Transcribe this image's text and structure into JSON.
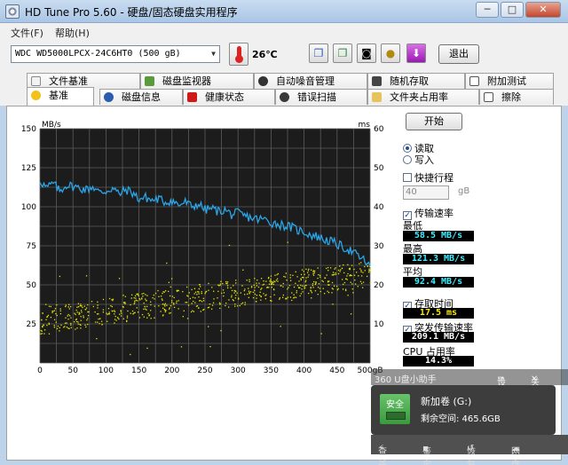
{
  "window": {
    "title": "HD Tune Pro 5.60 - 硬盘/固态硬盘实用程序",
    "buttons": [
      "─",
      "□",
      "✕"
    ]
  },
  "menu": [
    "文件(F)",
    "帮助(H)"
  ],
  "toolbar": {
    "drive": "WDC WD5000LPCX-24C6HT0 (500 gB)",
    "temperature": "26℃",
    "exit_label": "退出",
    "tool_icons": [
      "copy-icon",
      "paste-icon",
      "camera-icon",
      "coins-icon",
      "download-icon"
    ]
  },
  "tabs": {
    "row1": [
      "文件基准",
      "磁盘监视器",
      "自动噪音管理",
      "随机存取",
      "附加测试"
    ],
    "row2": [
      "基准",
      "磁盘信息",
      "健康状态",
      "错误扫描",
      "文件夹占用率",
      "擦除"
    ],
    "active": "基准"
  },
  "controls": {
    "start_label": "开始",
    "read_label": "读取",
    "write_label": "写入",
    "short_stroke_label": "快捷行程",
    "short_stroke_value": "40",
    "short_stroke_unit": "gB",
    "transfer_rate_label": "传输速率",
    "min_label": "最低",
    "min_value": "58.5 MB/s",
    "max_label": "最高",
    "max_value": "121.3 MB/s",
    "avg_label": "平均",
    "avg_value": "92.4 MB/s",
    "access_time_label": "存取时间",
    "access_time_value": "17.5 ms",
    "burst_label": "突发传输速率",
    "burst_value": "209.1 MB/s",
    "cpu_label": "CPU 占用率",
    "cpu_value": "14.3%"
  },
  "overlay": {
    "title": "360 U盘小助手",
    "settings": "设置",
    "close": "关闭",
    "safe": "安全",
    "volume_name": "新加卷 (G:)",
    "free_space": "剩余空间: 465.6GB",
    "actions": [
      "查杀",
      "鉴定",
      "恢复",
      "网盘"
    ]
  },
  "colors": {
    "transfer_line": "#2aa5e8",
    "access_points": "#e6e600",
    "chart_bg": "#1c1c1c"
  },
  "chart_data": {
    "type": "line",
    "xlabel": "",
    "x_unit": "gB",
    "left_unit": "MB/s",
    "right_unit": "ms",
    "xlim": [
      0,
      500
    ],
    "ylim_left": [
      0,
      150
    ],
    "ylim_right": [
      0,
      60
    ],
    "x_ticks": [
      0,
      50,
      100,
      150,
      200,
      250,
      300,
      350,
      400,
      450,
      500
    ],
    "y_ticks_left": [
      25,
      50,
      75,
      100,
      125,
      150
    ],
    "y_ticks_right": [
      10,
      20,
      30,
      40,
      50,
      60
    ],
    "grid": true,
    "series": [
      {
        "name": "传输速率",
        "axis": "left",
        "x": [
          0,
          10,
          20,
          30,
          40,
          50,
          60,
          70,
          80,
          90,
          100,
          110,
          120,
          130,
          140,
          150,
          160,
          170,
          180,
          190,
          200,
          210,
          220,
          230,
          240,
          250,
          260,
          270,
          280,
          290,
          300,
          310,
          320,
          330,
          340,
          350,
          360,
          370,
          380,
          390,
          400,
          410,
          420,
          430,
          440,
          450,
          460,
          470,
          480,
          490,
          500
        ],
        "values": [
          117,
          112,
          115,
          110,
          114,
          113,
          112,
          111,
          113,
          109,
          110,
          112,
          108,
          111,
          109,
          105,
          106,
          104,
          105,
          103,
          104,
          101,
          103,
          100,
          102,
          98,
          99,
          97,
          98,
          95,
          96,
          94,
          93,
          92,
          92,
          90,
          89,
          88,
          87,
          85,
          84,
          82,
          81,
          79,
          78,
          76,
          74,
          72,
          69,
          66,
          62
        ]
      },
      {
        "name": "存取时间",
        "axis": "right",
        "type": "scatter",
        "trend_start_ms": 11,
        "trend_end_ms": 23,
        "spread_ms": 7,
        "count": 700
      }
    ]
  }
}
